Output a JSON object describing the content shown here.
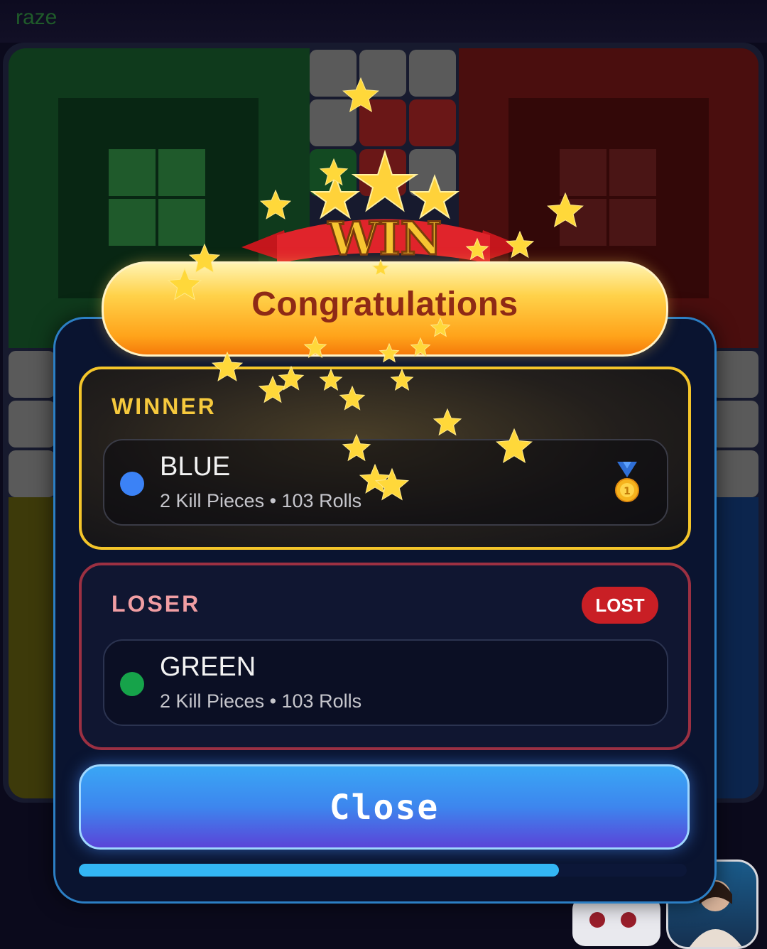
{
  "app": {
    "player_name": "raze"
  },
  "banner": {
    "win_label": "WIN",
    "title": "Congratulations"
  },
  "winner": {
    "section_label": "WINNER",
    "name": "BLUE",
    "color": "#3b82f6",
    "stats": "2 Kill Pieces • 103 Rolls",
    "icon": "medal-icon"
  },
  "loser": {
    "section_label": "LOSER",
    "badge": "LOST",
    "name": "GREEN",
    "color": "#16a34a",
    "stats": "2 Kill Pieces • 103 Rolls"
  },
  "actions": {
    "close_label": "Close"
  },
  "progress": {
    "fraction": 0.79
  }
}
